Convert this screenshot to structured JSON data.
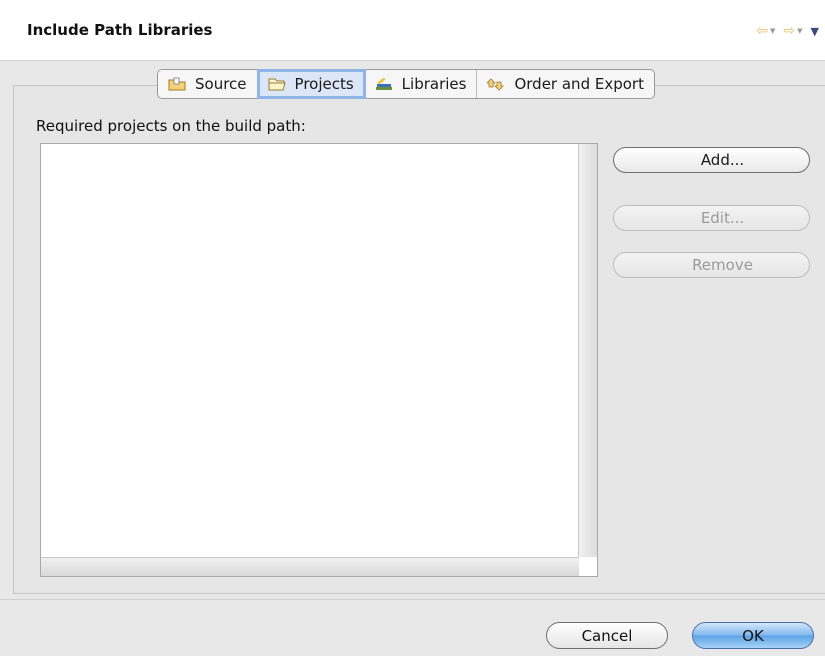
{
  "dialog": {
    "title": "Include Path Libraries",
    "nav": {
      "back_icon": "back-arrow-icon",
      "forward_icon": "forward-arrow-icon",
      "menu_icon": "view-menu-icon"
    }
  },
  "tabs": [
    {
      "label": "Source",
      "icon": "source-folder-icon",
      "active": false
    },
    {
      "label": "Projects",
      "icon": "open-folder-icon",
      "active": true
    },
    {
      "label": "Libraries",
      "icon": "books-icon",
      "active": false
    },
    {
      "label": "Order and Export",
      "icon": "order-arrows-icon",
      "active": false
    }
  ],
  "projects": {
    "label": "Required projects on the build path:",
    "items": []
  },
  "side_buttons": {
    "add": "Add...",
    "edit": "Edit...",
    "remove": "Remove"
  },
  "footer": {
    "cancel": "Cancel",
    "ok": "OK"
  },
  "colors": {
    "accent_blue": "#5aa2e6",
    "active_tab_outline": "#8fb4e8",
    "nav_arrow": "#e7c06a"
  }
}
